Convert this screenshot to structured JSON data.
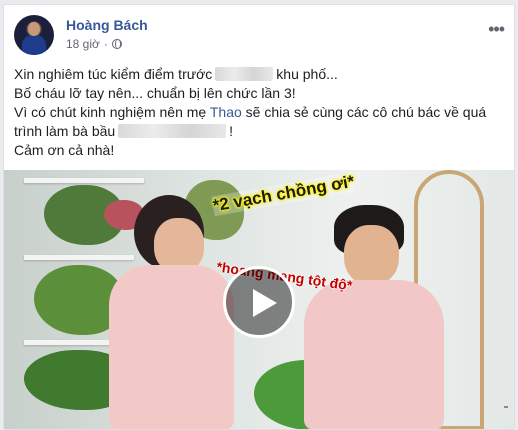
{
  "post": {
    "author": "Hoàng Bách",
    "time": "18 giờ",
    "more_icon": "more-options-icon",
    "privacy_icon": "globe-icon",
    "lines": [
      {
        "before": "Xin nghiêm túc kiểm điểm trước",
        "after": "khu phố..."
      },
      {
        "text": "Bố cháu lỡ tay nên... chuẩn bị lên chức lần 3!"
      },
      {
        "before": "Vì có chút kinh nghiệm nên mẹ ",
        "highlight": "Thao",
        "after": " sẽ chia sẻ cùng các cô chú bác về quá"
      },
      {
        "before": "trình làm bà bầu",
        "after": "!"
      },
      {
        "text": "Cảm ơn cả nhà!"
      }
    ]
  },
  "video": {
    "caption_top": "*2 vạch chồng ơi*",
    "caption_middle": "*hoang mang tột độ*",
    "play_icon": "play-icon",
    "accent": "#385898"
  }
}
